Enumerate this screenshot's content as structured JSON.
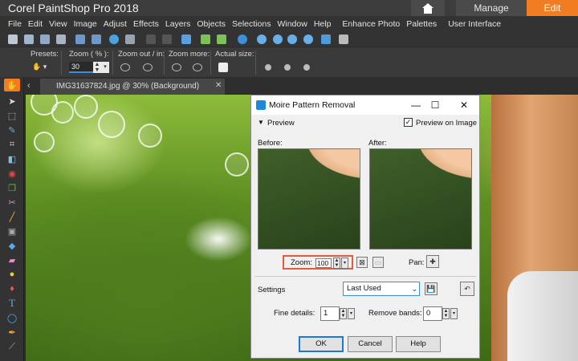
{
  "app": {
    "title": "Corel PaintShop Pro 2018"
  },
  "workspace_tabs": {
    "manage": "Manage",
    "edit": "Edit"
  },
  "menu": [
    "File",
    "Edit",
    "View",
    "Image",
    "Adjust",
    "Effects",
    "Layers",
    "Objects",
    "Selections",
    "Window",
    "Help",
    "Enhance Photo",
    "Palettes",
    "User Interface"
  ],
  "tool_options": {
    "presets_label": "Presets:",
    "zoom_label": "Zoom ( % ):",
    "zoom_value": "30",
    "zoom_out_in_label": "Zoom out / in:",
    "zoom_more_label": "Zoom more:",
    "actual_size_label": "Actual size:"
  },
  "document": {
    "tab_label": "IMG31637824.jpg @  30% (Background)"
  },
  "dialog": {
    "title": "Moire Pattern Removal",
    "preview_section": "Preview",
    "preview_on_image_label": "Preview on Image",
    "preview_on_image_checked": true,
    "before_label": "Before:",
    "after_label": "After:",
    "zoom_label": "Zoom:",
    "zoom_value": "100",
    "pan_label": "Pan:",
    "settings_label": "Settings",
    "settings_value": "Last Used",
    "fine_details_label": "Fine details:",
    "fine_details_value": "1",
    "remove_bands_label": "Remove bands:",
    "remove_bands_value": "0",
    "ok_label": "OK",
    "cancel_label": "Cancel",
    "help_label": "Help"
  },
  "colors": {
    "accent": "#f27c22",
    "highlight": "#e85a3c",
    "focus": "#1e78d0"
  }
}
